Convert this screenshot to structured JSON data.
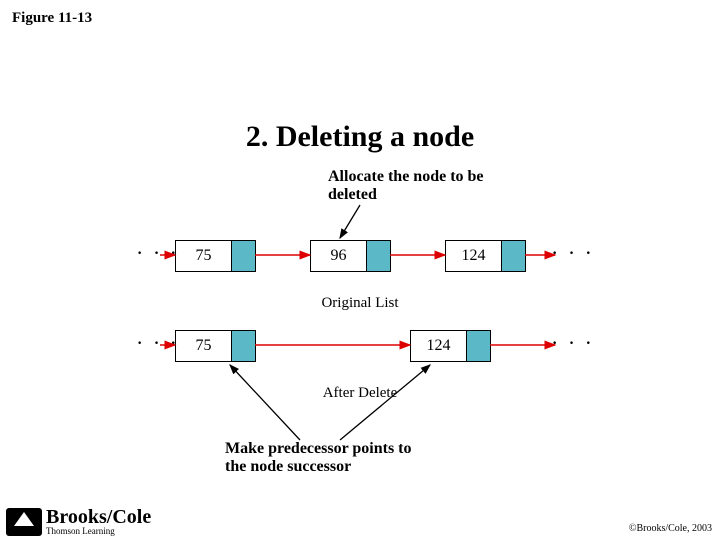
{
  "figure_label": "Figure 11-13",
  "title": "2. Deleting a node",
  "annotation_top": "Allocate the node to be\ndeleted",
  "annotation_bottom": "Make predecessor points to\nthe node successor",
  "original_list": {
    "caption": "Original List",
    "nodes": [
      "75",
      "96",
      "124"
    ]
  },
  "after_delete": {
    "caption": "After Delete",
    "nodes": [
      "75",
      "124"
    ]
  },
  "ellipsis": "· · ·",
  "logo": {
    "brand": "Brooks/Cole",
    "sub": "Thomson Learning"
  },
  "copyright": "©Brooks/Cole, 2003"
}
